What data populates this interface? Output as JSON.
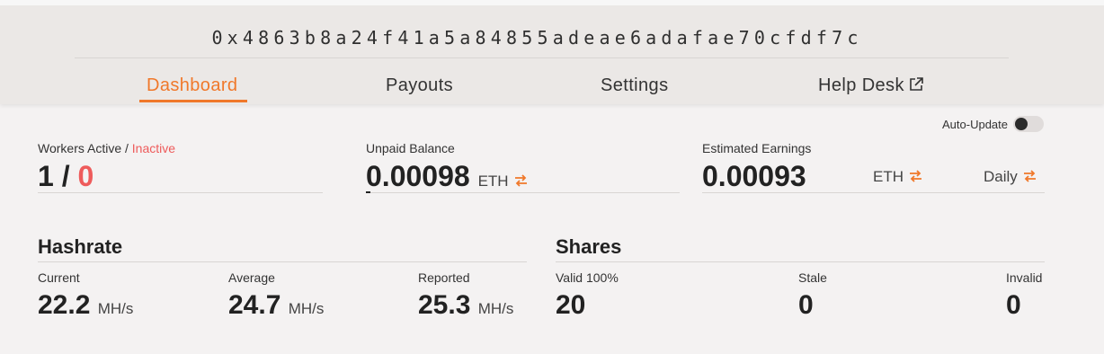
{
  "header": {
    "wallet_address": "0x4863b8a24f41a5a84855adeae6adafae70cfdf7c"
  },
  "nav": {
    "dashboard": "Dashboard",
    "payouts": "Payouts",
    "settings": "Settings",
    "help_desk": "Help Desk"
  },
  "auto_update": {
    "label": "Auto-Update",
    "enabled": false
  },
  "workers": {
    "label_active": "Workers Active",
    "label_sep": " / ",
    "label_inactive": "Inactive",
    "active": "1",
    "sep": " / ",
    "inactive": "0"
  },
  "unpaid": {
    "label": "Unpaid Balance",
    "value": "0.00098",
    "unit": "ETH"
  },
  "earnings": {
    "label": "Estimated Earnings",
    "value": "0.00093",
    "unit": "ETH",
    "period": "Daily"
  },
  "hashrate": {
    "title": "Hashrate",
    "current": {
      "label": "Current",
      "value": "22.2",
      "unit": "MH/s"
    },
    "average": {
      "label": "Average",
      "value": "24.7",
      "unit": "MH/s"
    },
    "reported": {
      "label": "Reported",
      "value": "25.3",
      "unit": "MH/s"
    }
  },
  "shares": {
    "title": "Shares",
    "valid": {
      "label": "Valid 100%",
      "value": "20"
    },
    "stale": {
      "label": "Stale",
      "value": "0"
    },
    "invalid": {
      "label": "Invalid",
      "value": "0"
    }
  },
  "colors": {
    "accent": "#f0782a",
    "inactive_red": "#ee5b5b"
  }
}
